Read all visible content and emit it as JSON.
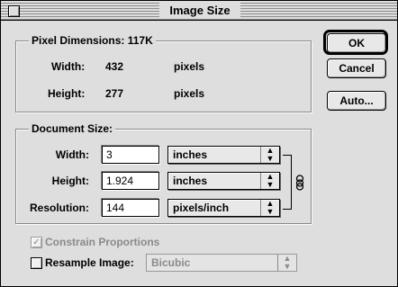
{
  "window": {
    "title": "Image Size"
  },
  "pixel_dimensions": {
    "title": "Pixel Dimensions:",
    "size": "117K",
    "width_label": "Width:",
    "width_value": "432",
    "width_unit": "pixels",
    "height_label": "Height:",
    "height_value": "277",
    "height_unit": "pixels"
  },
  "document_size": {
    "title": "Document Size:",
    "width_label": "Width:",
    "width_value": "3",
    "width_unit": "inches",
    "height_label": "Height:",
    "height_value": "1.924",
    "height_unit": "inches",
    "resolution_label": "Resolution:",
    "resolution_value": "144",
    "resolution_unit": "pixels/inch"
  },
  "options": {
    "constrain_label": "Constrain Proportions",
    "constrain_checked": true,
    "resample_label": "Resample Image:",
    "resample_checked": false,
    "resample_method": "Bicubic"
  },
  "buttons": {
    "ok": "OK",
    "cancel": "Cancel",
    "auto": "Auto..."
  },
  "icons": {
    "up_down": "▲▼",
    "check": "✓"
  }
}
